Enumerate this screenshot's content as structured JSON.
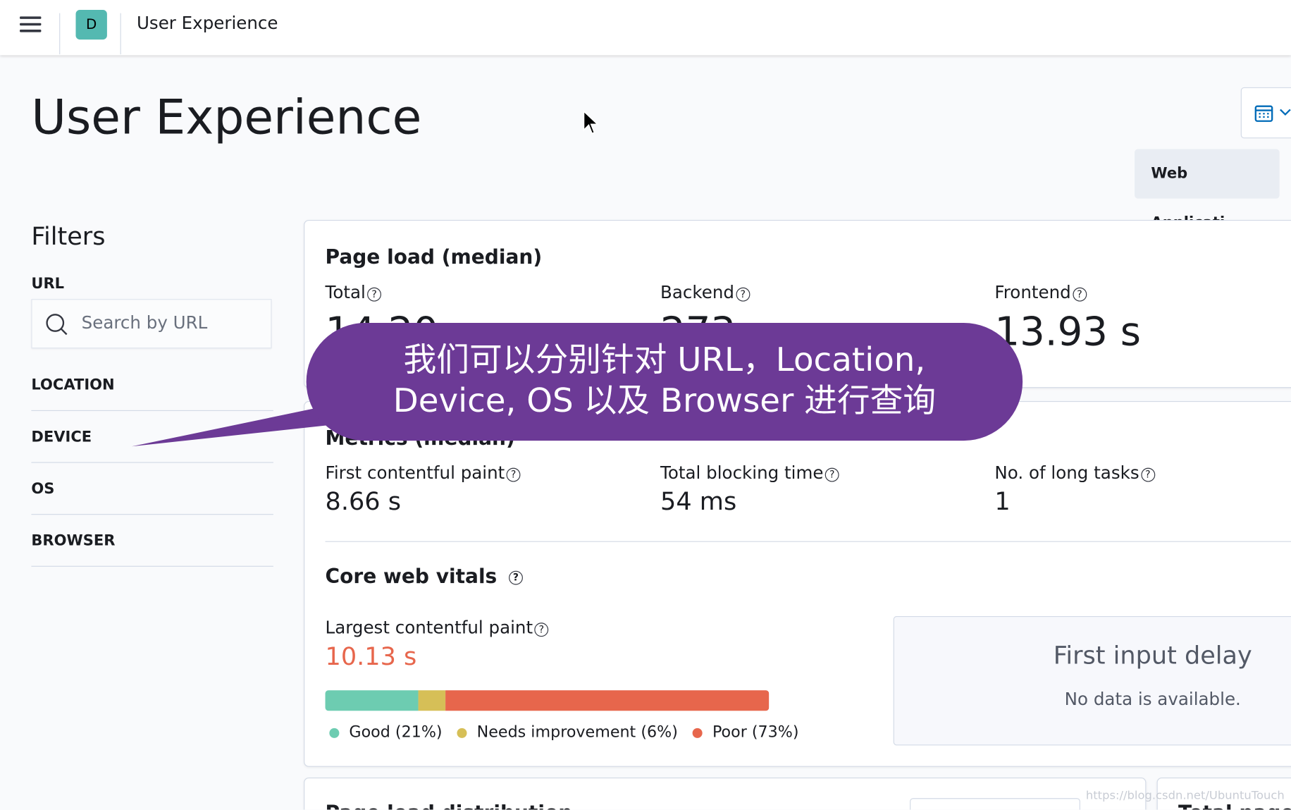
{
  "header": {
    "app_initial": "D",
    "breadcrumb": "User Experience"
  },
  "page": {
    "title": "User Experience",
    "service_button": "Web Applicati..."
  },
  "filters": {
    "title": "Filters",
    "url_label": "URL",
    "search_placeholder": "Search by URL",
    "items": [
      "LOCATION",
      "DEVICE",
      "OS",
      "BROWSER"
    ]
  },
  "page_load": {
    "title": "Page load (median)",
    "metrics": [
      {
        "label": "Total",
        "value": "14.20 s"
      },
      {
        "label": "Backend",
        "value": "273 ms"
      },
      {
        "label": "Frontend",
        "value": "13.93 s"
      }
    ]
  },
  "metrics": {
    "title": "Metrics (median)",
    "items": [
      {
        "label": "First contentful paint",
        "value": "8.66 s"
      },
      {
        "label": "Total blocking time",
        "value": "54 ms"
      },
      {
        "label": "No. of long tasks",
        "value": "1"
      }
    ]
  },
  "core_web_vitals": {
    "title": "Core web vitals",
    "lcp_label": "Largest contentful paint",
    "lcp_value": "10.13 s",
    "lcp_color": "#e7664c",
    "bar": [
      {
        "label": "Good (21%)",
        "pct": 21,
        "color": "#6dccb1"
      },
      {
        "label": "Needs improvement (6%)",
        "pct": 6,
        "color": "#d6bf57"
      },
      {
        "label": "Poor (73%)",
        "pct": 73,
        "color": "#e7664c"
      }
    ],
    "fid_title": "First input delay",
    "fid_empty": "No data is available."
  },
  "bottom": {
    "page_load_dist": "Page load distribution",
    "total_page_views": "Total page views"
  },
  "annotation": {
    "line1": "我们可以分别针对 URL，Location,",
    "line2": "Device, OS 以及 Browser 进行查询"
  },
  "watermark": "https://blog.csdn.net/UbuntuTouch"
}
